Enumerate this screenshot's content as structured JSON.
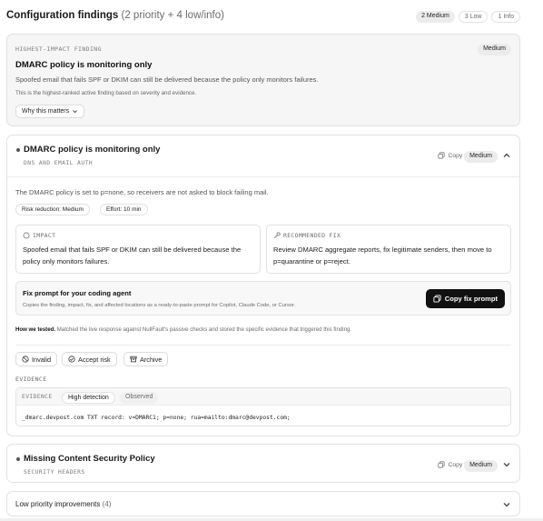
{
  "header": {
    "title": "Configuration findings",
    "subtitle": "(2 priority + 4 low/info)",
    "badges": [
      "2 Medium",
      "3 Low",
      "1 Info"
    ]
  },
  "highlight": {
    "label": "HIGHEST-IMPACT FINDING",
    "severity": "Medium",
    "title": "DMARC policy is monitoring only",
    "description": "Spoofed email that fails SPF or DKIM can still be delivered because the policy only monitors failures.",
    "note": "This is the highest-ranked active finding based on severity and evidence.",
    "why_label": "Why this matters"
  },
  "finding": {
    "title": "DMARC policy is monitoring only",
    "category": "DNS AND EMAIL AUTH",
    "copy_fix": "Copy fix",
    "severity": "Medium",
    "description": "The DMARC policy is set to p=none, so receivers are not asked to block failing mail.",
    "tags": [
      "Risk reduction: Medium",
      "Effort: 10 min"
    ],
    "impact_label": "IMPACT",
    "impact_text": "Spoofed email that fails SPF or DKIM can still be delivered because the policy only monitors failures.",
    "fix_label": "RECOMMENDED FIX",
    "fix_text": "Review DMARC aggregate reports, fix legitimate senders, then move to p=quarantine or p=reject.",
    "prompt_title": "Fix prompt for your coding agent",
    "prompt_sub": "Copies the finding, impact, fix, and affected locations as a ready-to-paste prompt for Copilot, Claude Code, or Cursor.",
    "prompt_button": "Copy fix prompt",
    "tested_label": "How we tested.",
    "tested_text": "Matched the live response against NullFault's passive checks and stored the specific evidence that triggered this finding.",
    "actions": [
      "Invalid",
      "Accept risk",
      "Archive"
    ],
    "evidence_label": "EVIDENCE",
    "evidence_head": "EVIDENCE",
    "evidence_pills": [
      "High detection",
      "Observed"
    ],
    "evidence_code": "_dmarc.devpost.com TXT record: v=DMARC1; p=none; rua=mailto:dmarc@devpost.com;"
  },
  "csp": {
    "title": "Missing Content Security Policy",
    "category": "SECURITY HEADERS",
    "copy_fix": "Copy fix",
    "severity": "Medium"
  },
  "low": {
    "label": "Low priority improvements",
    "count": "(4)"
  }
}
